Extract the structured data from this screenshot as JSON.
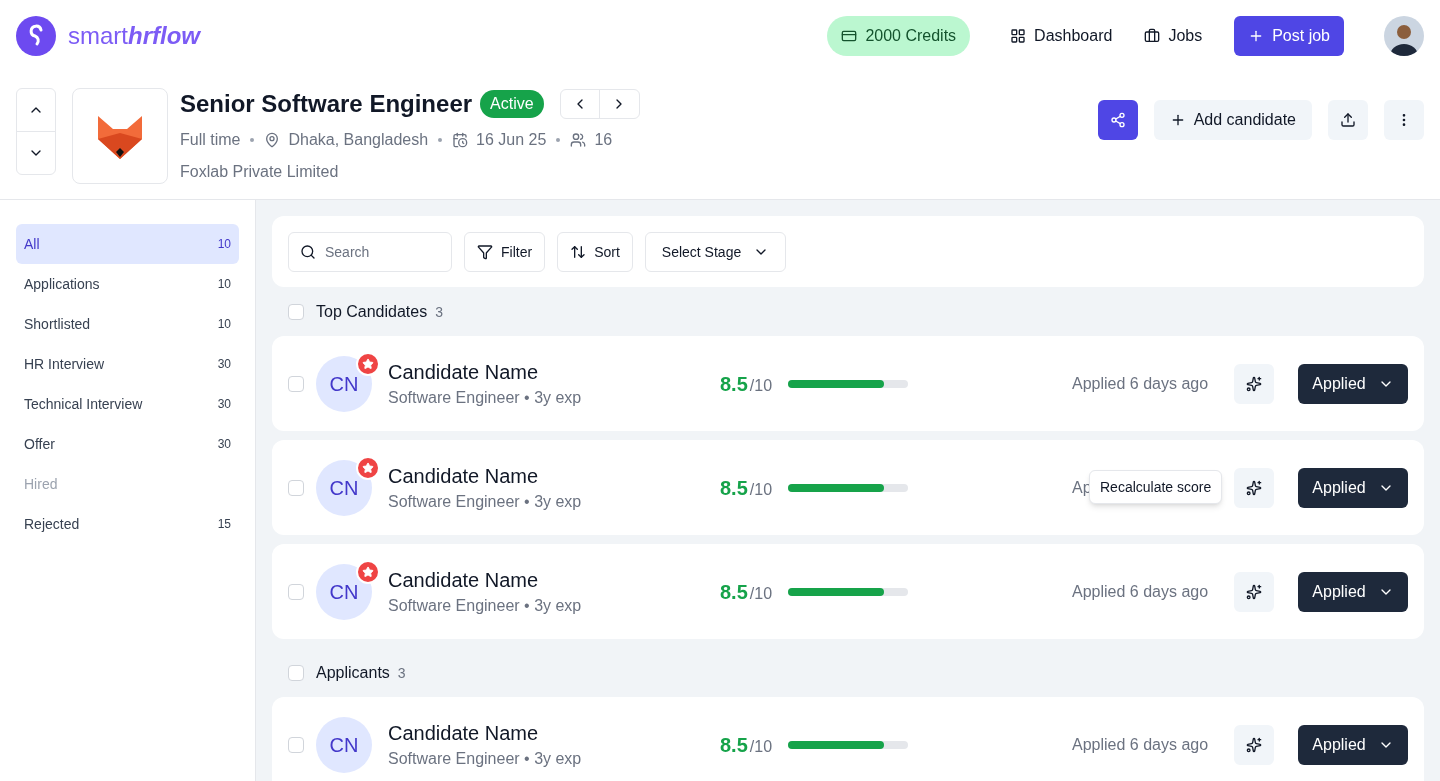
{
  "brand": {
    "name_light": "smart",
    "name_bold": "hrflow"
  },
  "nav": {
    "credits": "2000 Credits",
    "links": [
      "Dashboard",
      "Jobs"
    ],
    "post_job": "Post job"
  },
  "job": {
    "title": "Senior Software Engineer",
    "status": "Active",
    "type": "Full time",
    "location": "Dhaka, Bangladesh",
    "date": "16 Jun 25",
    "applicants": "16",
    "company": "Foxlab Private Limited",
    "add_candidate": "Add candidate"
  },
  "sidebar": {
    "items": [
      {
        "label": "All",
        "count": "10",
        "selected": true,
        "disabled": false
      },
      {
        "label": "Applications",
        "count": "10",
        "selected": false,
        "disabled": false
      },
      {
        "label": "Shortlisted",
        "count": "10",
        "selected": false,
        "disabled": false
      },
      {
        "label": "HR Interview",
        "count": "30",
        "selected": false,
        "disabled": false
      },
      {
        "label": "Technical Interview",
        "count": "30",
        "selected": false,
        "disabled": false
      },
      {
        "label": "Offer",
        "count": "30",
        "selected": false,
        "disabled": false
      },
      {
        "label": "Hired",
        "selected": false,
        "disabled": true
      },
      {
        "label": "Rejected",
        "count": "15",
        "selected": false,
        "disabled": false
      }
    ]
  },
  "toolbar": {
    "search_placeholder": "Search",
    "filter": "Filter",
    "sort": "Sort",
    "stage": "Select Stage"
  },
  "groups": [
    {
      "title": "Top Candidates",
      "count": "3",
      "checked": false,
      "candidates": [
        {
          "initials": "CN",
          "name": "Candidate Name",
          "role": "Software Engineer • 3y exp",
          "starred": true,
          "score": "8.5",
          "score_max": "/10",
          "level": 0.8,
          "applied": "Applied 6 days ago",
          "status": "Applied",
          "checked": false
        },
        {
          "initials": "CN",
          "name": "Candidate Name",
          "role": "Software Engineer • 3y exp",
          "starred": true,
          "score": "8.5",
          "score_max": "/10",
          "level": 0.8,
          "applied": "Ap",
          "tooltip": "Recalculate score",
          "status": "Applied",
          "checked": false
        },
        {
          "initials": "CN",
          "name": "Candidate Name",
          "role": "Software Engineer • 3y exp",
          "starred": true,
          "score": "8.5",
          "score_max": "/10",
          "level": 0.8,
          "applied": "Applied 6 days ago",
          "status": "Applied",
          "checked": false
        }
      ]
    },
    {
      "title": "Applicants",
      "count": "3",
      "checked": false,
      "candidates": [
        {
          "initials": "CN",
          "name": "Candidate Name",
          "role": "Software Engineer • 3y exp",
          "starred": false,
          "score": "8.5",
          "score_max": "/10",
          "level": 0.8,
          "applied": "Applied 6 days ago",
          "status": "Applied",
          "checked": false
        }
      ]
    }
  ]
}
